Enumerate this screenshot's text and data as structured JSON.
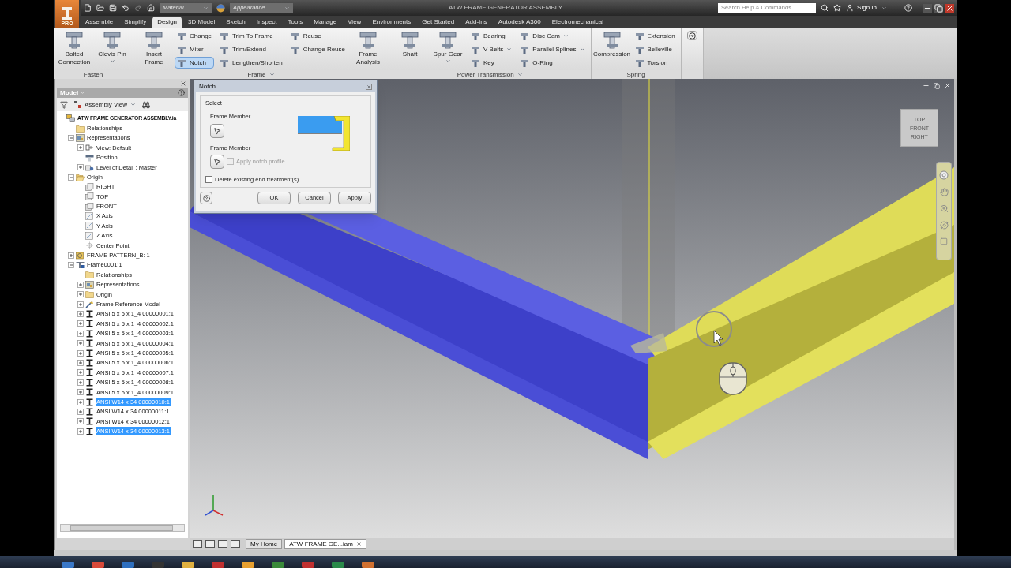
{
  "app_button": {
    "label": "PRO"
  },
  "quick_access": {
    "material": {
      "placeholder": "Material"
    },
    "appearance": {
      "placeholder": "Appearance"
    }
  },
  "window": {
    "title": "ATW FRAME GENERATOR ASSEMBLY"
  },
  "search": {
    "placeholder": "Search Help & Commands..."
  },
  "account": {
    "label": "Sign In"
  },
  "tabs": [
    {
      "label": "Assemble",
      "selected": false
    },
    {
      "label": "Simplify",
      "selected": false
    },
    {
      "label": "Design",
      "selected": true
    },
    {
      "label": "3D Model",
      "selected": false
    },
    {
      "label": "Sketch",
      "selected": false
    },
    {
      "label": "Inspect",
      "selected": false
    },
    {
      "label": "Tools",
      "selected": false
    },
    {
      "label": "Manage",
      "selected": false
    },
    {
      "label": "View",
      "selected": false
    },
    {
      "label": "Environments",
      "selected": false
    },
    {
      "label": "Get Started",
      "selected": false
    },
    {
      "label": "Add-Ins",
      "selected": false
    },
    {
      "label": "Autodesk A360",
      "selected": false
    },
    {
      "label": "Electromechanical",
      "selected": false
    }
  ],
  "ribbon": {
    "panels": [
      {
        "title": "Fasten",
        "dropdown": false,
        "groups": [
          {
            "kind": "large",
            "label": "Bolted Connection",
            "selected": false,
            "dropdown": false
          },
          {
            "kind": "large",
            "label": "Clevis Pin",
            "selected": false,
            "dropdown": true
          }
        ]
      },
      {
        "title": "Frame",
        "dropdown": true,
        "groups": [
          {
            "kind": "large",
            "label": "Insert Frame",
            "selected": false,
            "dropdown": false
          },
          {
            "kind": "stack",
            "items": [
              {
                "label": "Change",
                "selected": false,
                "dropdown": false
              },
              {
                "label": "Miter",
                "selected": false,
                "dropdown": false
              },
              {
                "label": "Notch",
                "selected": true,
                "dropdown": false
              }
            ]
          },
          {
            "kind": "stack",
            "items": [
              {
                "label": "Trim To Frame",
                "selected": false,
                "dropdown": false
              },
              {
                "label": "Trim/Extend",
                "selected": false,
                "dropdown": false
              },
              {
                "label": "Lengthen/Shorten",
                "selected": false,
                "dropdown": false
              }
            ]
          },
          {
            "kind": "stack",
            "items": [
              {
                "label": "Reuse",
                "selected": false,
                "dropdown": false
              },
              {
                "label": "Change Reuse",
                "selected": false,
                "dropdown": false
              }
            ]
          },
          {
            "kind": "large",
            "label": "Frame Analysis",
            "selected": false,
            "dropdown": false
          }
        ]
      },
      {
        "title": "Power Transmission",
        "dropdown": true,
        "groups": [
          {
            "kind": "large",
            "label": "Shaft",
            "selected": false,
            "dropdown": false
          },
          {
            "kind": "large",
            "label": "Spur Gear",
            "selected": false,
            "dropdown": true
          },
          {
            "kind": "stack",
            "items": [
              {
                "label": "Bearing",
                "selected": false,
                "dropdown": false
              },
              {
                "label": "V-Belts",
                "selected": false,
                "dropdown": true
              },
              {
                "label": "Key",
                "selected": false,
                "dropdown": false
              }
            ]
          },
          {
            "kind": "stack",
            "items": [
              {
                "label": "Disc Cam",
                "selected": false,
                "dropdown": true
              },
              {
                "label": "Parallel Splines",
                "selected": false,
                "dropdown": true
              },
              {
                "label": "O-Ring",
                "selected": false,
                "dropdown": false
              }
            ]
          }
        ]
      },
      {
        "title": "Spring",
        "dropdown": false,
        "groups": [
          {
            "kind": "large",
            "label": "Compression",
            "selected": false,
            "dropdown": false
          },
          {
            "kind": "stack",
            "items": [
              {
                "label": "Extension",
                "selected": false,
                "dropdown": false
              },
              {
                "label": "Belleville",
                "selected": false,
                "dropdown": false
              },
              {
                "label": "Torsion",
                "selected": false,
                "dropdown": false
              }
            ]
          }
        ]
      }
    ]
  },
  "browser": {
    "title": "Model",
    "view": "Assembly View",
    "tree": [
      {
        "label": "ATW FRAME GENERATOR ASSEMBLY.ia",
        "kind": "assembly",
        "selected": false,
        "children": [
          {
            "label": "Relationships",
            "kind": "folder",
            "selected": false
          },
          {
            "label": "Representations",
            "kind": "representations",
            "expanded": true,
            "selected": false,
            "children": [
              {
                "label": "View: Default",
                "kind": "view",
                "expanded": false,
                "selected": false
              },
              {
                "label": "Position",
                "kind": "position",
                "selected": false
              },
              {
                "label": "Level of Detail : Master",
                "kind": "detail",
                "expanded": false,
                "selected": false
              }
            ]
          },
          {
            "label": "Origin",
            "kind": "folder-open",
            "expanded": true,
            "selected": false,
            "children": [
              {
                "label": "RIGHT",
                "kind": "plane",
                "selected": false
              },
              {
                "label": "TOP",
                "kind": "plane",
                "selected": false
              },
              {
                "label": "FRONT",
                "kind": "plane",
                "selected": false
              },
              {
                "label": "X Axis",
                "kind": "axis",
                "selected": false
              },
              {
                "label": "Y Axis",
                "kind": "axis",
                "selected": false
              },
              {
                "label": "Z Axis",
                "kind": "axis",
                "selected": false
              },
              {
                "label": "Center Point",
                "kind": "point",
                "selected": false
              }
            ]
          },
          {
            "label": "FRAME PATTERN_B: 1",
            "kind": "pattern",
            "expanded": false,
            "selected": false
          },
          {
            "label": "Frame0001:1",
            "kind": "frame",
            "expanded": true,
            "selected": false,
            "children": [
              {
                "label": "Relationships",
                "kind": "folder",
                "selected": false
              },
              {
                "label": "Representations",
                "kind": "representations",
                "expanded": false,
                "selected": false
              },
              {
                "label": "Origin",
                "kind": "folder",
                "expanded": false,
                "selected": false
              },
              {
                "label": "Frame Reference Model",
                "kind": "reference",
                "expanded": false,
                "selected": false
              },
              {
                "label": "ANSI 5 x 5 x 1_4 00000001:1",
                "kind": "member",
                "expanded": false,
                "selected": false
              },
              {
                "label": "ANSI 5 x 5 x 1_4 00000002:1",
                "kind": "member",
                "expanded": false,
                "selected": false
              },
              {
                "label": "ANSI 5 x 5 x 1_4 00000003:1",
                "kind": "member",
                "expanded": false,
                "selected": false
              },
              {
                "label": "ANSI 5 x 5 x 1_4 00000004:1",
                "kind": "member",
                "expanded": false,
                "selected": false
              },
              {
                "label": "ANSI 5 x 5 x 1_4 00000005:1",
                "kind": "member",
                "expanded": false,
                "selected": false
              },
              {
                "label": "ANSI 5 x 5 x 1_4 00000006:1",
                "kind": "member",
                "expanded": false,
                "selected": false
              },
              {
                "label": "ANSI 5 x 5 x 1_4 00000007:1",
                "kind": "member",
                "expanded": false,
                "selected": false
              },
              {
                "label": "ANSI 5 x 5 x 1_4 00000008:1",
                "kind": "member",
                "expanded": false,
                "selected": false
              },
              {
                "label": "ANSI 5 x 5 x 1_4 00000009:1",
                "kind": "member",
                "expanded": false,
                "selected": false
              },
              {
                "label": "ANSI W14 x 34 00000010:1",
                "kind": "member",
                "expanded": false,
                "selected": true
              },
              {
                "label": "ANSI W14 x 34 00000011:1",
                "kind": "member",
                "expanded": false,
                "selected": false
              },
              {
                "label": "ANSI W14 x 34 00000012:1",
                "kind": "member",
                "expanded": false,
                "selected": false
              },
              {
                "label": "ANSI W14 x 34 00000013:1",
                "kind": "member",
                "expanded": false,
                "selected": true
              }
            ]
          }
        ]
      }
    ]
  },
  "dialog": {
    "title": "Notch",
    "group": "Select",
    "first_label": "Frame Member",
    "second_label": "Frame Member",
    "apply_profile": {
      "label": "Apply notch profile",
      "checked": false,
      "disabled": true
    },
    "delete_treatment": {
      "label": "Delete existing end treatment(s)",
      "checked": false,
      "disabled": false
    },
    "buttons": [
      "OK",
      "Cancel",
      "Apply"
    ]
  },
  "view_cube": {
    "faces": [
      "TOP",
      "FRONT",
      "RIGHT"
    ]
  },
  "document_tabs": [
    {
      "label": "My Home",
      "selected": false
    },
    {
      "label": "ATW FRAME GE...iam",
      "selected": true
    }
  ]
}
